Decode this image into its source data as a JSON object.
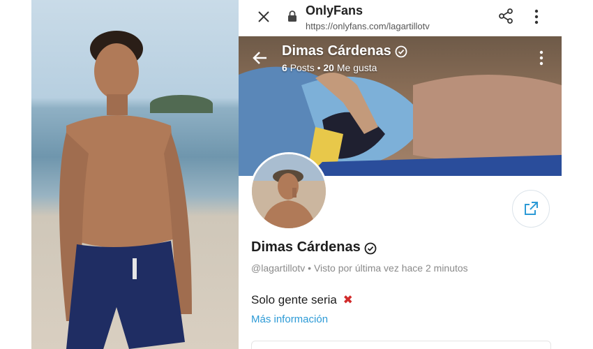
{
  "browser": {
    "site_title": "OnlyFans",
    "url": "https://onlyfans.com/lagartillotv"
  },
  "cover": {
    "name": "Dimas Cárdenas",
    "posts_count": "6",
    "posts_label": "Posts",
    "likes_count": "20",
    "likes_label": "Me gusta",
    "separator": "•"
  },
  "profile": {
    "name": "Dimas Cárdenas",
    "handle": "@lagartillotv",
    "status": "Visto por última vez hace 2 minutos",
    "bio_text": "Solo gente seria",
    "bio_emoji": "✖",
    "more_info": "Más información"
  },
  "colors": {
    "accent": "#2c9ad6",
    "verified": "#1d1d1d",
    "red_x": "#d12b2b"
  },
  "icons": {
    "close": "close-icon",
    "lock": "lock-icon",
    "share": "share-icon",
    "kebab": "kebab-menu-icon",
    "back": "back-arrow-icon",
    "verified": "verified-badge-icon",
    "share_profile": "share-profile-icon"
  }
}
